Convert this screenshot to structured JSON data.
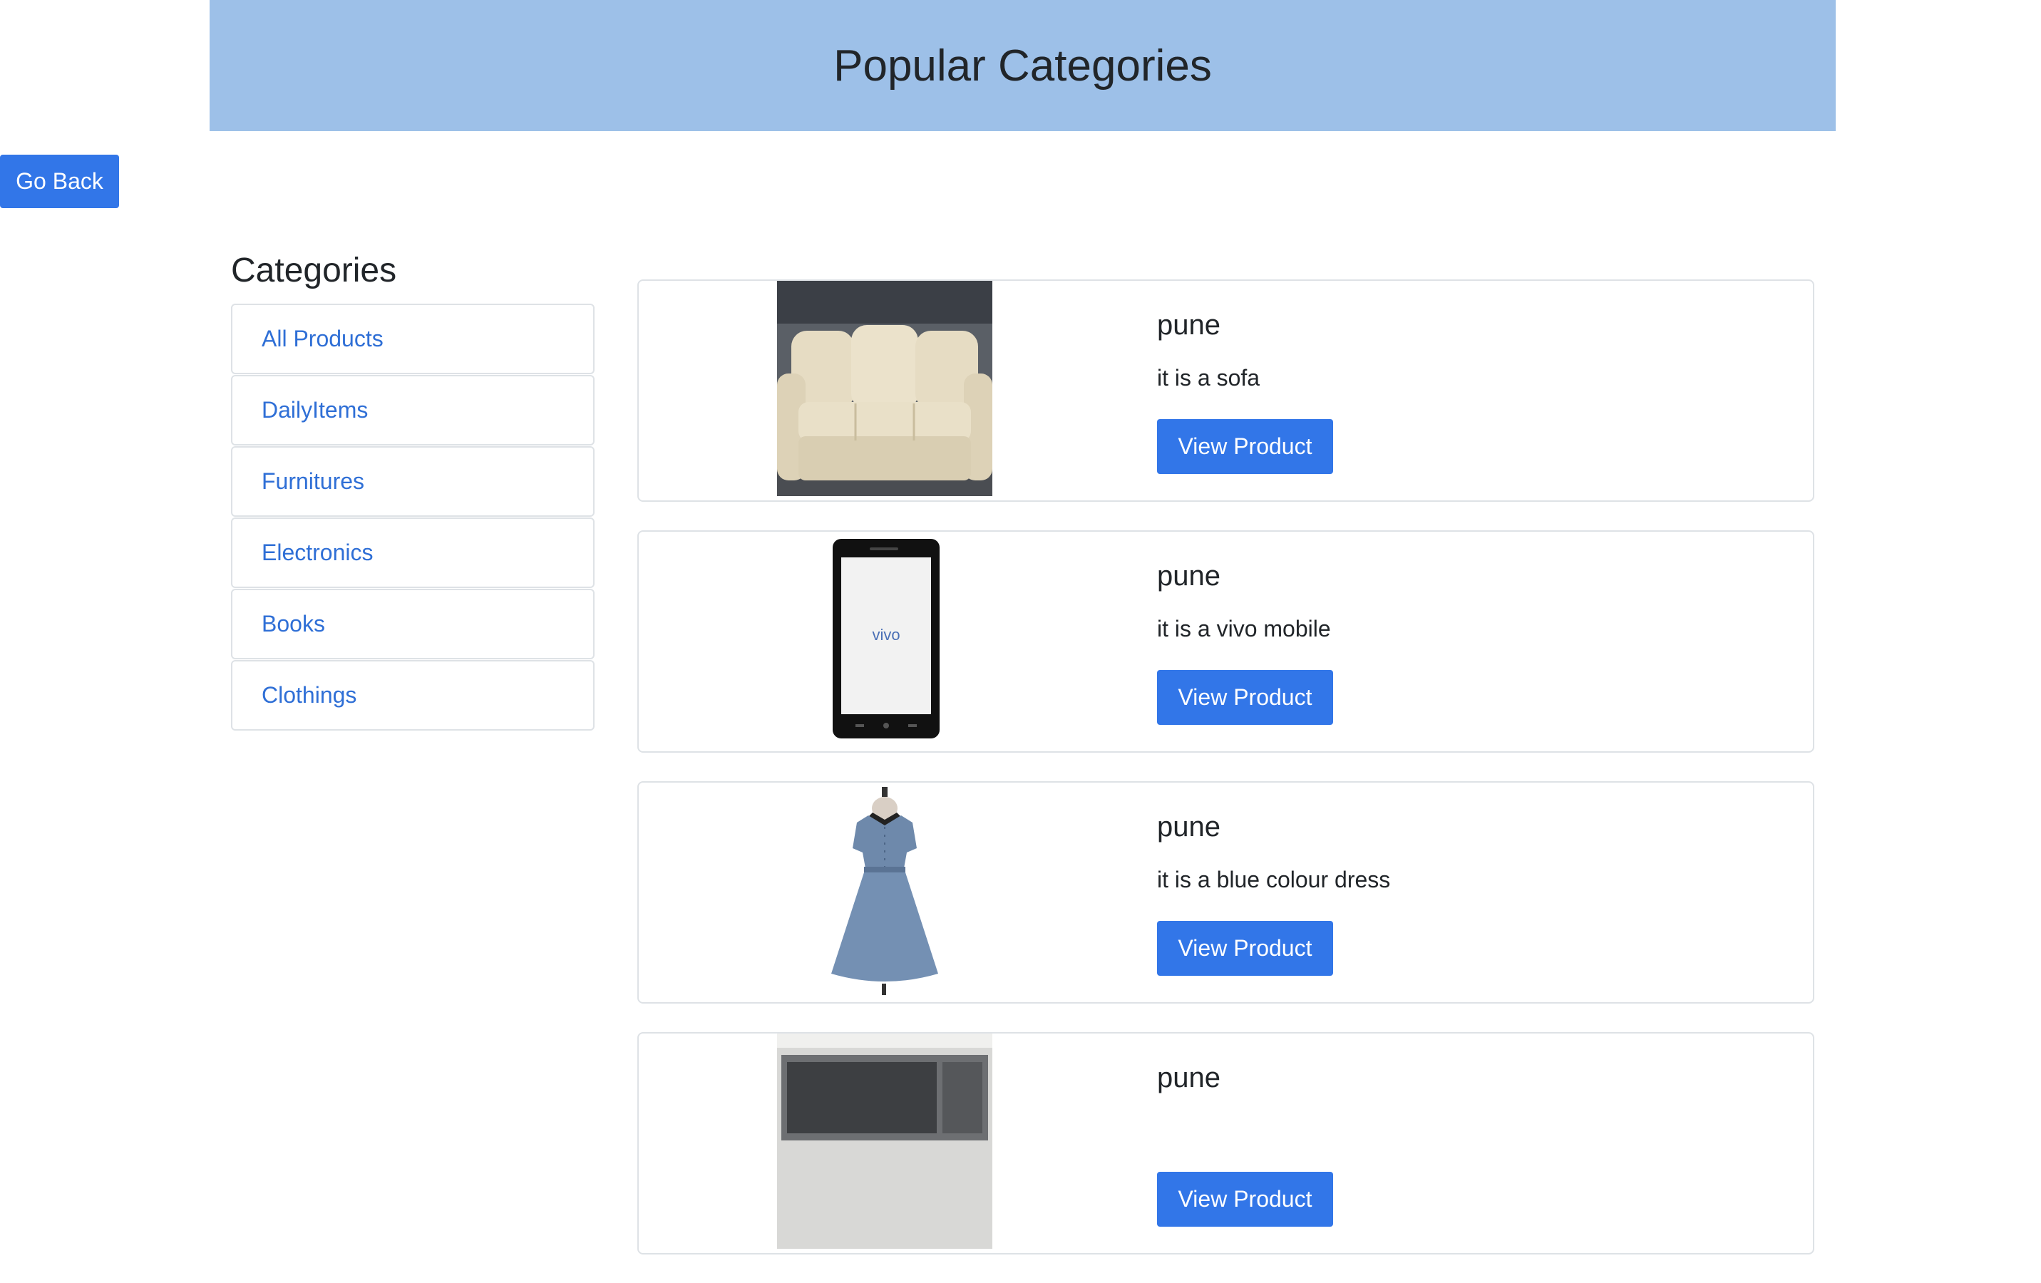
{
  "header": {
    "title": "Popular Categories",
    "background_color": "#9dc0e8"
  },
  "go_back": {
    "label": "Go Back",
    "color": "#3276e8"
  },
  "sidebar": {
    "heading": "Categories",
    "items": [
      {
        "label": "All Products"
      },
      {
        "label": "DailyItems"
      },
      {
        "label": "Furnitures"
      },
      {
        "label": "Electronics"
      },
      {
        "label": "Books"
      },
      {
        "label": "Clothings"
      }
    ],
    "link_color": "#2f6fd6"
  },
  "products": [
    {
      "title": "pune",
      "description": "it is a sofa",
      "button": "View Product",
      "image_icon": "sofa-image"
    },
    {
      "title": "pune",
      "description": "it is a vivo mobile",
      "button": "View Product",
      "image_icon": "phone-image",
      "brand": "vivo"
    },
    {
      "title": "pune",
      "description": "it is a blue colour dress",
      "button": "View Product",
      "image_icon": "dress-image"
    },
    {
      "title": "pune",
      "description": "",
      "button": "View Product",
      "image_icon": "microwave-image"
    }
  ],
  "accent_color": "#3276e8"
}
